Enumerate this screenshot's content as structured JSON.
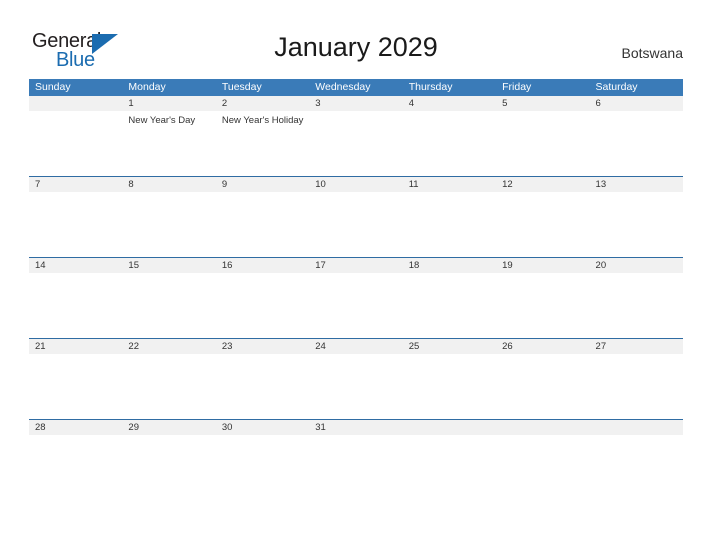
{
  "brand": {
    "word_one": "General",
    "word_two": "Blue",
    "flag_icon": "triangle-flag-icon",
    "black": "#231f20",
    "blue": "#1b6cb0"
  },
  "header": {
    "title": "January 2029",
    "region": "Botswana"
  },
  "theme": {
    "header_blue": "#3a7bb8",
    "row_separator_blue": "#2f6ca3",
    "date_strip_gray": "#f1f1f1",
    "text": "#333333"
  },
  "calendar": {
    "weekdays": [
      "Sunday",
      "Monday",
      "Tuesday",
      "Wednesday",
      "Thursday",
      "Friday",
      "Saturday"
    ],
    "weeks": [
      {
        "days": [
          {
            "num": "",
            "events": []
          },
          {
            "num": "1",
            "events": [
              "New Year's Day"
            ]
          },
          {
            "num": "2",
            "events": [
              "New Year's Holiday"
            ]
          },
          {
            "num": "3",
            "events": []
          },
          {
            "num": "4",
            "events": []
          },
          {
            "num": "5",
            "events": []
          },
          {
            "num": "6",
            "events": []
          }
        ]
      },
      {
        "days": [
          {
            "num": "7",
            "events": []
          },
          {
            "num": "8",
            "events": []
          },
          {
            "num": "9",
            "events": []
          },
          {
            "num": "10",
            "events": []
          },
          {
            "num": "11",
            "events": []
          },
          {
            "num": "12",
            "events": []
          },
          {
            "num": "13",
            "events": []
          }
        ]
      },
      {
        "days": [
          {
            "num": "14",
            "events": []
          },
          {
            "num": "15",
            "events": []
          },
          {
            "num": "16",
            "events": []
          },
          {
            "num": "17",
            "events": []
          },
          {
            "num": "18",
            "events": []
          },
          {
            "num": "19",
            "events": []
          },
          {
            "num": "20",
            "events": []
          }
        ]
      },
      {
        "days": [
          {
            "num": "21",
            "events": []
          },
          {
            "num": "22",
            "events": []
          },
          {
            "num": "23",
            "events": []
          },
          {
            "num": "24",
            "events": []
          },
          {
            "num": "25",
            "events": []
          },
          {
            "num": "26",
            "events": []
          },
          {
            "num": "27",
            "events": []
          }
        ]
      },
      {
        "days": [
          {
            "num": "28",
            "events": []
          },
          {
            "num": "29",
            "events": []
          },
          {
            "num": "30",
            "events": []
          },
          {
            "num": "31",
            "events": []
          },
          {
            "num": "",
            "events": []
          },
          {
            "num": "",
            "events": []
          },
          {
            "num": "",
            "events": []
          }
        ]
      }
    ]
  }
}
